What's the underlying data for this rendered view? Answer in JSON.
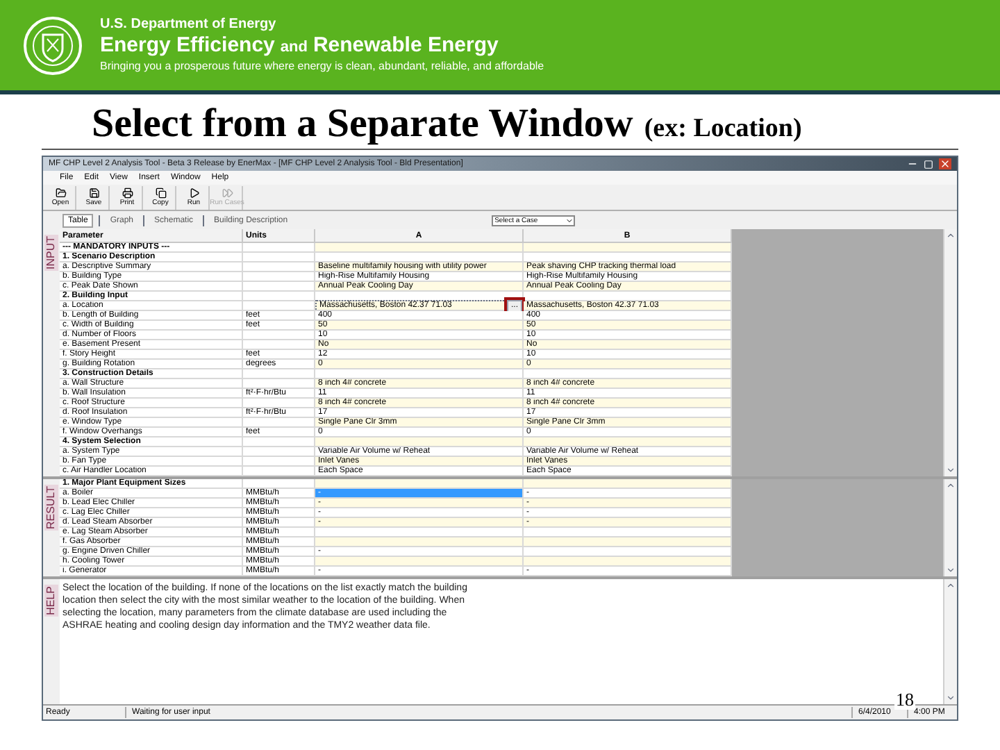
{
  "header": {
    "agency": "U.S. Department of Energy",
    "office": [
      "Energy Efficiency",
      "and",
      "Renewable Energy"
    ],
    "tagline": "Bringing you a prosperous future where energy is clean, abundant, reliable, and affordable"
  },
  "slide_title": "Select from a Separate Window",
  "slide_subtitle": "(ex: Location)",
  "window": {
    "title": "MF CHP Level 2 Analysis Tool - Beta 3 Release by EnerMax - [MF CHP Level 2 Analysis Tool - Bld Presentation]",
    "menu": [
      "File",
      "Edit",
      "View",
      "Insert",
      "Window",
      "Help"
    ],
    "toolbar": [
      {
        "label": "Open",
        "disabled": false
      },
      {
        "label": "Save",
        "disabled": false
      },
      {
        "label": "Print",
        "disabled": false
      },
      {
        "label": "Copy",
        "disabled": false
      },
      {
        "label": "Run",
        "disabled": false
      },
      {
        "label": "Run Cases",
        "disabled": true
      }
    ],
    "tabs": [
      {
        "label": "Table",
        "selected": true
      },
      {
        "label": "Graph",
        "selected": false
      },
      {
        "label": "Schematic",
        "selected": false
      },
      {
        "label": "Building Description",
        "selected": false
      }
    ],
    "case_select": "Select a Case",
    "section_labels": [
      "INPUT",
      "RESULT",
      "HELP"
    ],
    "columns": [
      "Parameter",
      "Units",
      "A",
      "B"
    ],
    "input_rows": [
      {
        "kind": "heading",
        "label": "--- MANDATORY INPUTS ---"
      },
      {
        "kind": "section",
        "label": "1.  Scenario Description"
      },
      {
        "kind": "param",
        "label": "a. Descriptive Summary",
        "unit": "",
        "a": "Baseline multifamily housing with utility power",
        "b": "Peak shaving CHP tracking thermal load"
      },
      {
        "kind": "param",
        "label": "b. Building Type",
        "unit": "",
        "a": "High-Rise Multifamily Housing",
        "b": "High-Rise Multifamily Housing"
      },
      {
        "kind": "param",
        "label": "c. Peak Date Shown",
        "unit": "",
        "a": "Annual Peak Cooling Day",
        "b": "Annual Peak Cooling Day"
      },
      {
        "kind": "section",
        "label": "2.  Building Input"
      },
      {
        "kind": "picker",
        "label": "a. Location",
        "unit": "",
        "a": "Massachusetts, Boston 42.37 71.03",
        "b": "Massachusetts, Boston 42.37 71.03",
        "button": "...",
        "highlighted": true
      },
      {
        "kind": "param",
        "label": "b. Length of Building",
        "unit": "feet",
        "a": "400",
        "b": "400"
      },
      {
        "kind": "param",
        "label": "c. Width of Building",
        "unit": "feet",
        "a": "50",
        "b": "50"
      },
      {
        "kind": "param",
        "label": "d. Number of Floors",
        "unit": "",
        "a": "10",
        "b": "10"
      },
      {
        "kind": "param",
        "label": "e. Basement Present",
        "unit": "",
        "a": "No",
        "b": "No"
      },
      {
        "kind": "param",
        "label": "f. Story Height",
        "unit": "feet",
        "a": "12",
        "b": "10"
      },
      {
        "kind": "param",
        "label": "g. Building Rotation",
        "unit": "degrees",
        "a": "0",
        "b": "0"
      },
      {
        "kind": "section",
        "label": "3.  Construction Details"
      },
      {
        "kind": "param",
        "label": "a. Wall Structure",
        "unit": "",
        "a": "8 inch 4# concrete",
        "b": "8 inch 4# concrete"
      },
      {
        "kind": "param",
        "label": "b. Wall Insulation",
        "unit": "ft²·F·hr/Btu",
        "a": "11",
        "b": "11"
      },
      {
        "kind": "param",
        "label": "c. Roof Structure",
        "unit": "",
        "a": "8 inch 4# concrete",
        "b": "8 inch 4# concrete"
      },
      {
        "kind": "param",
        "label": "d. Roof Insulation",
        "unit": "ft²·F·hr/Btu",
        "a": "17",
        "b": "17"
      },
      {
        "kind": "param",
        "label": "e. Window Type",
        "unit": "",
        "a": "Single Pane Clr 3mm",
        "b": "Single Pane Clr 3mm"
      },
      {
        "kind": "param",
        "label": "f. Window Overhangs",
        "unit": "feet",
        "a": "0",
        "b": "0"
      },
      {
        "kind": "section",
        "label": "4.  System Selection"
      },
      {
        "kind": "param",
        "label": "a. System Type",
        "unit": "",
        "a": "Variable Air Volume w/ Reheat",
        "b": "Variable Air Volume w/ Reheat"
      },
      {
        "kind": "param",
        "label": "b. Fan Type",
        "unit": "",
        "a": "Inlet Vanes",
        "b": "Inlet Vanes"
      },
      {
        "kind": "param",
        "label": "c. Air Handler Location",
        "unit": "",
        "a": "Each Space",
        "b": "Each Space"
      }
    ],
    "result_rows": [
      {
        "kind": "section",
        "label": "1.  Major Plant Equipment Sizes"
      },
      {
        "kind": "param",
        "label": "a. Boiler",
        "unit": "MMBtu/h",
        "a": "-",
        "b": "-",
        "selected": true
      },
      {
        "kind": "param",
        "label": "b. Lead Elec Chiller",
        "unit": "MMBtu/h",
        "a": "-",
        "b": "-",
        "selected": false
      },
      {
        "kind": "param",
        "label": "c. Lag Elec Chiller",
        "unit": "MMBtu/h",
        "a": "-",
        "b": "-",
        "selected": false
      },
      {
        "kind": "param",
        "label": "d. Lead Steam Absorber",
        "unit": "MMBtu/h",
        "a": "-",
        "b": "-",
        "selected": false
      },
      {
        "kind": "param",
        "label": "e. Lag Steam Absorber",
        "unit": "MMBtu/h",
        "a": "",
        "b": "",
        "selected": false
      },
      {
        "kind": "param",
        "label": "f. Gas Absorber",
        "unit": "MMBtu/h",
        "a": "",
        "b": "",
        "selected": false
      },
      {
        "kind": "param",
        "label": "g. Engine Driven Chiller",
        "unit": "MMBtu/h",
        "a": "-",
        "b": "",
        "selected": false
      },
      {
        "kind": "param",
        "label": "h. Cooling Tower",
        "unit": "MMBtu/h",
        "a": "",
        "b": "",
        "selected": false
      },
      {
        "kind": "param",
        "label": "i. Generator",
        "unit": "MMBtu/h",
        "a": "-",
        "b": "-",
        "selected": false
      }
    ],
    "help_text": "Select the location of the building. If none of the locations on the list exactly match the building location then select the city with the most similar weather to the location of the building. When selecting the location, many parameters from the climate database are used including the ASHRAE heating and cooling design day information and the TMY2 weather data file.",
    "status_bar": [
      "Ready",
      "Waiting for user input",
      "6/4/2010",
      "4:00 PM"
    ]
  },
  "page_number": "18"
}
